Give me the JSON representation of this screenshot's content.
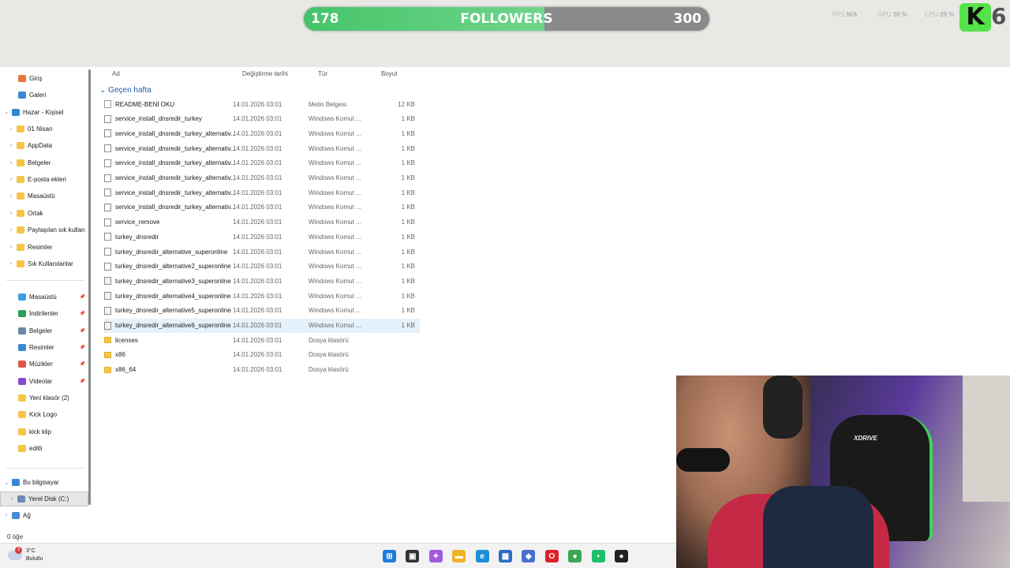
{
  "overlay": {
    "followers_current": "178",
    "followers_title": "FOLLOWERS",
    "followers_goal": "300",
    "followers_progress": 0.593,
    "fps_label": "FPS",
    "fps_value": "N/A",
    "gpu_label": "GPU",
    "gpu_value": "30 %",
    "cpu_label": "CPU",
    "cpu_value": "29 %",
    "kick_logo_letter": "K",
    "kick_number": "6"
  },
  "sidebar": {
    "items": [
      {
        "label": "Giriş",
        "icon": "home-icon",
        "color": "#e8743b"
      },
      {
        "label": "Galeri",
        "icon": "gallery-icon",
        "color": "#3b86d6"
      },
      {
        "label": "Hazar - Kişisel",
        "icon": "cloud-icon",
        "color": "#2a8ad8",
        "expanded": true
      },
      {
        "label": "01 Nisan",
        "icon": "folder-icon"
      },
      {
        "label": "AppData",
        "icon": "folder-icon"
      },
      {
        "label": "Belgeler",
        "icon": "documents-icon"
      },
      {
        "label": "E-posta ekleri",
        "icon": "folder-icon"
      },
      {
        "label": "Masaüstü",
        "icon": "desktop-icon"
      },
      {
        "label": "Ortak",
        "icon": "folder-icon"
      },
      {
        "label": "Paylaşılan sık kullan",
        "icon": "folder-icon"
      },
      {
        "label": "Resimler",
        "icon": "pictures-icon"
      },
      {
        "label": "Sık Kullanılanlar",
        "icon": "folder-icon"
      }
    ],
    "quick": [
      {
        "label": "Masaüstü",
        "icon": "desktop-icon",
        "color": "#3b9ee0"
      },
      {
        "label": "İndirilenler",
        "icon": "download-icon",
        "color": "#2aa05a"
      },
      {
        "label": "Belgeler",
        "icon": "documents-icon",
        "color": "#6a86a8"
      },
      {
        "label": "Resimler",
        "icon": "pictures-icon",
        "color": "#3b86d6"
      },
      {
        "label": "Müzikler",
        "icon": "music-icon",
        "color": "#e0564a"
      },
      {
        "label": "Videolar",
        "icon": "videos-icon",
        "color": "#8a4ad8"
      },
      {
        "label": "Yeni klasör (2)",
        "icon": "folder-icon",
        "color": "#f6c547"
      },
      {
        "label": "Kick Logo",
        "icon": "folder-icon",
        "color": "#f6c547"
      },
      {
        "label": "kick klip",
        "icon": "folder-icon",
        "color": "#f6c547"
      },
      {
        "label": "editli",
        "icon": "folder-icon",
        "color": "#f6c547"
      }
    ],
    "this_pc": "Bu bilgisayar",
    "local_disk": "Yerel Disk (C:)",
    "network": "Ağ"
  },
  "columns": {
    "name": "Ad",
    "date": "Değiştirme tarihi",
    "type": "Tür",
    "size": "Boyut"
  },
  "group": "Geçen hafta",
  "files": [
    {
      "name": "README-BENİ OKU",
      "date": "14.01.2026 03:01",
      "type": "Metin Belgesi",
      "size": "12 KB",
      "kind": "txt"
    },
    {
      "name": "service_install_dnsredir_turkey",
      "date": "14.01.2026 03:01",
      "type": "Windows Komut ...",
      "size": "1 KB",
      "kind": "cmd"
    },
    {
      "name": "service_install_dnsredir_turkey_alternativ...",
      "date": "14.01.2026 03:01",
      "type": "Windows Komut ...",
      "size": "1 KB",
      "kind": "cmd"
    },
    {
      "name": "service_install_dnsredir_turkey_alternativ...",
      "date": "14.01.2026 03:01",
      "type": "Windows Komut ...",
      "size": "1 KB",
      "kind": "cmd"
    },
    {
      "name": "service_install_dnsredir_turkey_alternativ...",
      "date": "14.01.2026 03:01",
      "type": "Windows Komut ...",
      "size": "1 KB",
      "kind": "cmd"
    },
    {
      "name": "service_install_dnsredir_turkey_alternativ...",
      "date": "14.01.2026 03:01",
      "type": "Windows Komut ...",
      "size": "1 KB",
      "kind": "cmd"
    },
    {
      "name": "service_install_dnsredir_turkey_alternativ...",
      "date": "14.01.2026 03:01",
      "type": "Windows Komut ...",
      "size": "1 KB",
      "kind": "cmd"
    },
    {
      "name": "service_install_dnsredir_turkey_alternativ...",
      "date": "14.01.2026 03:01",
      "type": "Windows Komut ...",
      "size": "1 KB",
      "kind": "cmd"
    },
    {
      "name": "service_remove",
      "date": "14.01.2026 03:01",
      "type": "Windows Komut ...",
      "size": "1 KB",
      "kind": "cmd"
    },
    {
      "name": "turkey_dnsredir",
      "date": "14.01.2026 03:01",
      "type": "Windows Komut ...",
      "size": "1 KB",
      "kind": "cmd"
    },
    {
      "name": "turkey_dnsredir_alternative_superonline",
      "date": "14.01.2026 03:01",
      "type": "Windows Komut ...",
      "size": "1 KB",
      "kind": "cmd"
    },
    {
      "name": "turkey_dnsredir_alternative2_superonline",
      "date": "14.01.2026 03:01",
      "type": "Windows Komut ...",
      "size": "1 KB",
      "kind": "cmd"
    },
    {
      "name": "turkey_dnsredir_alternative3_superonline",
      "date": "14.01.2026 03:01",
      "type": "Windows Komut ...",
      "size": "1 KB",
      "kind": "sys"
    },
    {
      "name": "turkey_dnsredir_alternative4_superonline",
      "date": "14.01.2026 03:01",
      "type": "Windows Komut ...",
      "size": "1 KB",
      "kind": "sys"
    },
    {
      "name": "turkey_dnsredir_alternative5_superonline",
      "date": "14.01.2026 03:01",
      "type": "Windows Komut ...",
      "size": "1 KB",
      "kind": "sys"
    },
    {
      "name": "turkey_dnsredir_alternative6_superonline",
      "date": "14.01.2026 03:01",
      "type": "Windows Komut ...",
      "size": "1 KB",
      "kind": "sys",
      "hover": true
    },
    {
      "name": "licenses",
      "date": "14.01.2026 03:01",
      "type": "Dosya klasörü",
      "size": "",
      "kind": "dir"
    },
    {
      "name": "x86",
      "date": "14.01.2026 03:01",
      "type": "Dosya klasörü",
      "size": "",
      "kind": "dir"
    },
    {
      "name": "x86_64",
      "date": "14.01.2026 03:01",
      "type": "Dosya klasörü",
      "size": "",
      "kind": "dir"
    }
  ],
  "status": "0 öğe",
  "weather": {
    "temp": "3°C",
    "condition": "Bulutlu",
    "badge": "3"
  },
  "taskbar": [
    {
      "icon": "windows-start-icon",
      "color": "#1f7ae0",
      "glyph": "⊞"
    },
    {
      "icon": "task-view-icon",
      "color": "#333333",
      "glyph": "▣"
    },
    {
      "icon": "copilot-icon",
      "color": "#a45ae0",
      "glyph": "✦"
    },
    {
      "icon": "file-explorer-icon",
      "color": "#f0b429",
      "glyph": "▬"
    },
    {
      "icon": "edge-icon",
      "color": "#1d8fd6",
      "glyph": "e"
    },
    {
      "icon": "store-icon",
      "color": "#2b6cc4",
      "glyph": "▦"
    },
    {
      "icon": "app-icon",
      "color": "#4a6fd0",
      "glyph": "◆"
    },
    {
      "icon": "opera-icon",
      "color": "#e0202a",
      "glyph": "O"
    },
    {
      "icon": "chrome-icon",
      "color": "#3aa757",
      "glyph": "●"
    },
    {
      "icon": "kick-app-icon",
      "color": "#1fbf6a",
      "glyph": "▪"
    },
    {
      "icon": "obs-icon",
      "color": "#222222",
      "glyph": "●"
    }
  ],
  "webcam_chair_logo": "XDRIVE"
}
